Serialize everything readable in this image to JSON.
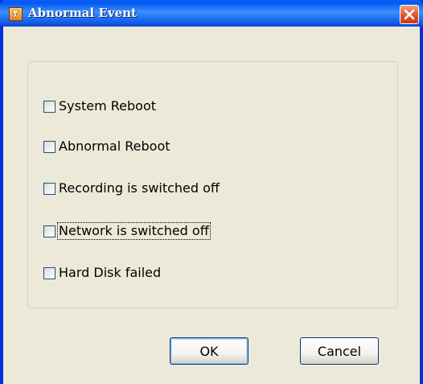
{
  "window": {
    "title": "Abnormal Event",
    "icon": "app-icon",
    "close_icon": "close-icon"
  },
  "options": [
    {
      "label": "System Reboot",
      "checked": false
    },
    {
      "label": "Abnormal Reboot",
      "checked": false
    },
    {
      "label": "Recording is switched off",
      "checked": false
    },
    {
      "label": "Network is switched off",
      "checked": false,
      "focused": true
    },
    {
      "label": "Hard Disk failed",
      "checked": false
    }
  ],
  "buttons": {
    "ok_label": "OK",
    "cancel_label": "Cancel"
  },
  "colors": {
    "titlebar": "#0a5fff",
    "dialog_bg": "#ece9d8",
    "close": "#e25426"
  }
}
